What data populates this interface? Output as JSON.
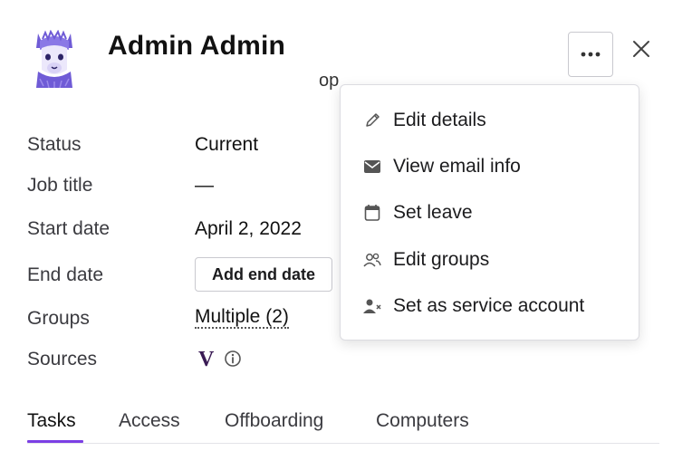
{
  "header": {
    "name": "Admin Admin",
    "subtitle_fragment": "op"
  },
  "fields": [
    {
      "label": "Status",
      "value": "Current"
    },
    {
      "label": "Job title",
      "value": "—"
    },
    {
      "label": "Start date",
      "value": "April 2, 2022"
    },
    {
      "label": "End date",
      "button": "Add end date"
    },
    {
      "label": "Groups",
      "link": "Multiple (2)"
    },
    {
      "label": "Sources",
      "source_glyph": "V",
      "icons": [
        "vercel-v-logo",
        "info-icon"
      ]
    }
  ],
  "menu": {
    "items": [
      {
        "label": "Edit details",
        "icon": "pencil-icon"
      },
      {
        "label": "View email info",
        "icon": "envelope-icon"
      },
      {
        "label": "Set leave",
        "icon": "calendar-icon"
      },
      {
        "label": "Edit groups",
        "icon": "users-icon"
      },
      {
        "label": "Set as service account",
        "icon": "user-x-icon"
      }
    ]
  },
  "tabs": [
    {
      "label": "Tasks",
      "active": true
    },
    {
      "label": "Access",
      "active": false
    },
    {
      "label": "Offboarding",
      "active": false
    },
    {
      "label": "Computers",
      "active": false
    }
  ],
  "colors": {
    "accent": "#7b3fe4",
    "avatar_purple": "#6f5bd6",
    "source_logo": "#3a1b55"
  }
}
